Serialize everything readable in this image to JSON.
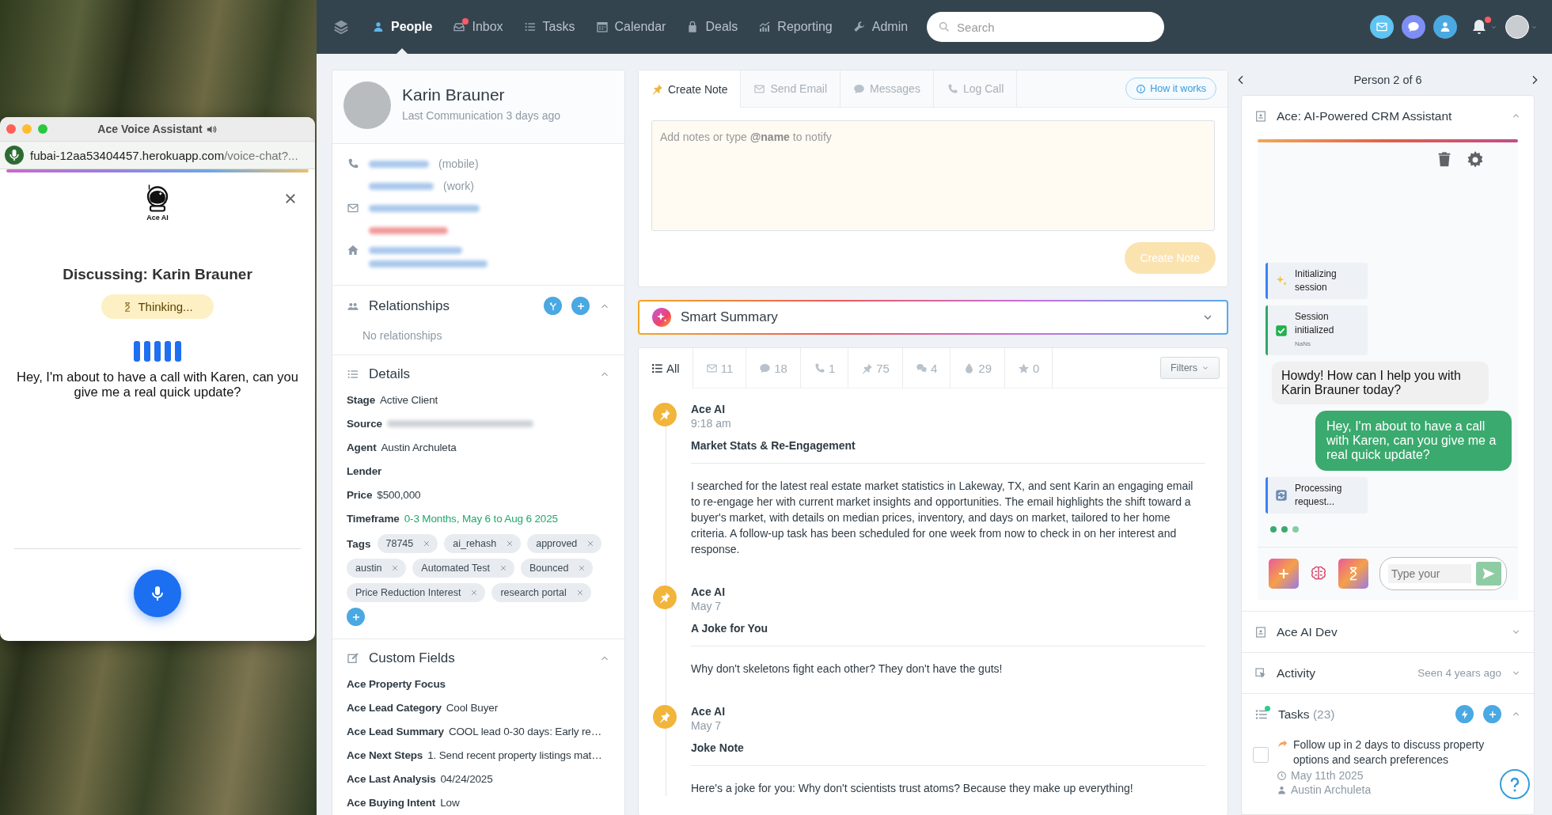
{
  "voice_window": {
    "title": "Ace Voice Assistant",
    "url_host": "fubai-12aa53404457.herokuapp.com",
    "url_path": "/voice-chat?...",
    "logo_label": "Ace AI",
    "heading": "Discussing: Karin Brauner",
    "status": "Thinking...",
    "transcript": "Hey, I'm about to have a call with Karen, can you give me a real quick update?"
  },
  "nav": {
    "items": [
      {
        "kind": "person",
        "label": "People",
        "selected": true,
        "badge": false
      },
      {
        "kind": "inbox",
        "label": "Inbox",
        "selected": false,
        "badge": true
      },
      {
        "kind": "list",
        "label": "Tasks",
        "selected": false,
        "badge": false
      },
      {
        "kind": "calendar",
        "label": "Calendar",
        "selected": false,
        "badge": false
      },
      {
        "kind": "deal",
        "label": "Deals",
        "selected": false,
        "badge": false
      },
      {
        "kind": "chart",
        "label": "Reporting",
        "selected": false,
        "badge": false
      },
      {
        "kind": "wrench",
        "label": "Admin",
        "selected": false,
        "badge": false
      }
    ],
    "search": {
      "placeholder": "Search"
    },
    "bell_badge": true
  },
  "contact": {
    "name": "Karin Brauner",
    "last_communication": "Last Communication 3 days ago",
    "phones": [
      {
        "label": "(mobile)"
      },
      {
        "label": "(work)"
      }
    ],
    "emails": [
      {
        "kind": "ok"
      },
      {
        "kind": "bounced"
      }
    ]
  },
  "relationships": {
    "title": "Relationships",
    "empty_text": "No relationships",
    "expanded": true
  },
  "details": {
    "title": "Details",
    "expanded": true,
    "fields": [
      {
        "kind": "text",
        "label": "Stage",
        "value": "Active Client"
      },
      {
        "kind": "blurred",
        "label": "Source"
      },
      {
        "kind": "text",
        "label": "Agent",
        "value": "Austin Archuleta"
      },
      {
        "kind": "empty",
        "label": "Lender"
      },
      {
        "kind": "text",
        "label": "Price",
        "value": "$500,000"
      },
      {
        "kind": "highlight",
        "label": "Timeframe",
        "value": "0-3 Months, May 6 to Aug 6 2025"
      }
    ],
    "tags_label": "Tags",
    "tags": [
      "78745",
      "ai_rehash",
      "approved",
      "austin",
      "Automated Test",
      "Bounced",
      "Price Reduction Interest",
      "research portal"
    ]
  },
  "custom_fields": {
    "title": "Custom Fields",
    "expanded": true,
    "fields": [
      {
        "label": "Ace Property Focus"
      },
      {
        "label": "Ace Lead Category",
        "value": "Cool Buyer"
      },
      {
        "label": "Ace Lead Summary",
        "value": "COOL lead 0-30 days: Early re…"
      },
      {
        "label": "Ace Next Steps",
        "value": "1. Send recent property listings mat…"
      },
      {
        "label": "Ace Last Analysis",
        "value": "04/24/2025"
      },
      {
        "label": "Ace Buying Intent",
        "value": "Low"
      }
    ]
  },
  "composer": {
    "tabs": [
      {
        "kind": "note",
        "label": "Create Note",
        "selected": true
      },
      {
        "kind": "email",
        "label": "Send Email",
        "selected": false
      },
      {
        "kind": "message",
        "label": "Messages",
        "selected": false
      },
      {
        "kind": "call",
        "label": "Log Call",
        "selected": false
      }
    ],
    "help_link": "How it works",
    "placeholder": "Add notes or type **@name** to notify",
    "submit": {
      "label": "Create Note",
      "disabled": true
    }
  },
  "smart_summary": {
    "title": "Smart Summary",
    "expanded": false
  },
  "activity_filters": {
    "tabs": [
      {
        "kind": "all",
        "label": "All",
        "selected": true
      },
      {
        "kind": "email",
        "label": "11",
        "selected": false
      },
      {
        "kind": "message",
        "label": "18",
        "selected": false
      },
      {
        "kind": "call",
        "label": "1",
        "selected": false
      },
      {
        "kind": "note",
        "label": "75",
        "selected": false
      },
      {
        "kind": "chat",
        "label": "4",
        "selected": false
      },
      {
        "kind": "drop",
        "label": "29",
        "selected": false
      },
      {
        "kind": "star",
        "label": "0",
        "selected": false
      }
    ],
    "filters_button": "Filters"
  },
  "timeline": [
    {
      "author": "Ace AI",
      "time": "9:18 am",
      "title": "Market Stats & Re-Engagement",
      "body": "I searched for the latest real estate market statistics in Lakeway, TX, and sent Karin an engaging email to re-engage her with current market insights and opportunities. The email highlights the shift toward a buyer's market, with details on median prices, inventory, and days on market, tailored to her home criteria. A follow-up task has been scheduled for one week from now to check in on her interest and response."
    },
    {
      "author": "Ace AI",
      "time": "May 7",
      "title": "A Joke for You",
      "body": "Why don't skeletons fight each other? They don't have the guts!"
    },
    {
      "author": "Ace AI",
      "time": "May 7",
      "title": "Joke Note",
      "body": "Here's a joke for you: Why don't scientists trust atoms? Because they make up everything!"
    }
  ],
  "pager": {
    "label": "Person 2 of 6"
  },
  "ace_panel": {
    "title": "Ace: AI-Powered CRM Assistant",
    "expanded": true,
    "messages": [
      {
        "kind": "starting",
        "text": "Initializing session"
      },
      {
        "kind": "done",
        "text": "Session initialized",
        "sub": "NaNs"
      },
      {
        "kind": "bot",
        "text": "Howdy! How can I help you with Karin Brauner today?"
      },
      {
        "kind": "user",
        "text": "Hey, I'm about to have a call with Karen, can you give me a real quick update?"
      },
      {
        "kind": "processing",
        "text": "Processing request..."
      }
    ],
    "typing": true,
    "input_placeholder": "Type your"
  },
  "sections": [
    {
      "kind": "dev",
      "title": "Ace AI Dev",
      "expanded": false
    },
    {
      "kind": "activity",
      "title": "Activity",
      "meta": "Seen 4 years ago",
      "expanded": false
    }
  ],
  "tasks": {
    "title": "Tasks",
    "count": "(23)",
    "expanded": true,
    "badge": true,
    "items": [
      {
        "text": "Follow up in 2 days to discuss property options and search preferences",
        "due": "May 11th 2025",
        "assignee": "Austin Archuleta",
        "checked": false
      }
    ]
  }
}
